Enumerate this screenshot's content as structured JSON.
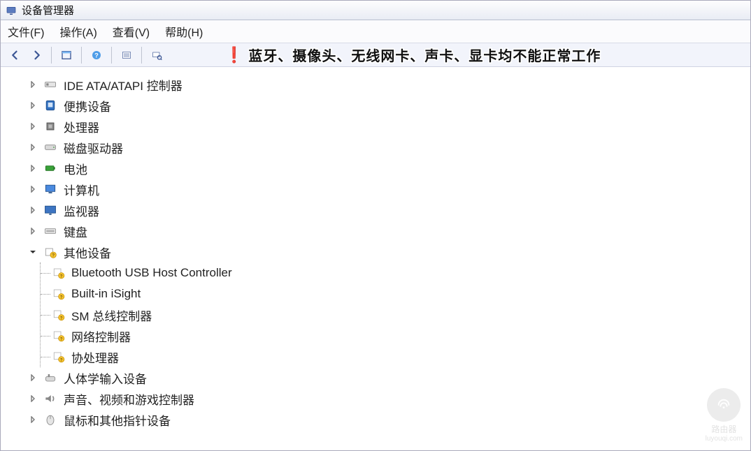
{
  "titlebar": {
    "title": "设备管理器"
  },
  "menu": {
    "file": "文件(F)",
    "action": "操作(A)",
    "view": "查看(V)",
    "help": "帮助(H)"
  },
  "toolbar": {
    "back": "后退",
    "forward": "前进",
    "up": "上级",
    "help": "帮助",
    "properties": "属性",
    "scan": "扫描检测硬件改动"
  },
  "alert": {
    "text": "蓝牙、摄像头、无线网卡、声卡、显卡均不能正常工作"
  },
  "tree": [
    {
      "label": "IDE ATA/ATAPI 控制器",
      "iconName": "ide-controller-icon",
      "expanded": false
    },
    {
      "label": "便携设备",
      "iconName": "portable-device-icon",
      "expanded": false
    },
    {
      "label": "处理器",
      "iconName": "cpu-icon",
      "expanded": false
    },
    {
      "label": "磁盘驱动器",
      "iconName": "disk-drive-icon",
      "expanded": false
    },
    {
      "label": "电池",
      "iconName": "battery-icon",
      "expanded": false
    },
    {
      "label": "计算机",
      "iconName": "computer-icon",
      "expanded": false
    },
    {
      "label": "监视器",
      "iconName": "monitor-icon",
      "expanded": false
    },
    {
      "label": "键盘",
      "iconName": "keyboard-icon",
      "expanded": false
    },
    {
      "label": "其他设备",
      "iconName": "other-devices-icon",
      "expanded": true,
      "children": [
        {
          "label": "Bluetooth USB Host Controller",
          "iconName": "unknown-device-icon"
        },
        {
          "label": "Built-in iSight",
          "iconName": "unknown-device-icon"
        },
        {
          "label": "SM 总线控制器",
          "iconName": "unknown-device-icon"
        },
        {
          "label": "网络控制器",
          "iconName": "unknown-device-icon"
        },
        {
          "label": "协处理器",
          "iconName": "unknown-device-icon"
        }
      ]
    },
    {
      "label": "人体学输入设备",
      "iconName": "hid-icon",
      "expanded": false
    },
    {
      "label": "声音、视频和游戏控制器",
      "iconName": "audio-icon",
      "expanded": false
    },
    {
      "label": "鼠标和其他指针设备",
      "iconName": "mouse-icon",
      "expanded": false
    }
  ],
  "watermark": {
    "brand": "路由器",
    "url": "luyouqi.com"
  }
}
